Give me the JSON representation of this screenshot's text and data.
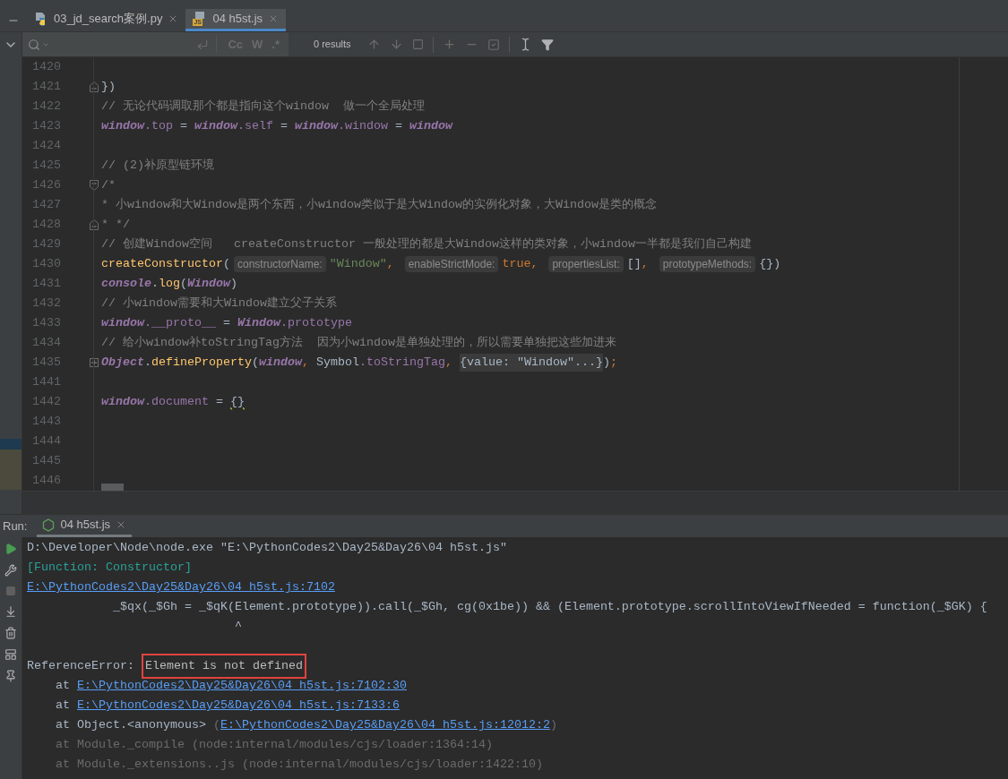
{
  "editor_tabs": [
    {
      "label": "03_jd_search案例.py",
      "selected": false
    },
    {
      "label": "04 h5st.js",
      "badge": "JS",
      "selected": true
    }
  ],
  "search_bar": {
    "toggles": [
      "Cc",
      "W",
      ".*"
    ],
    "results": "0 results"
  },
  "editor_lines": [
    {
      "number": "1420",
      "kind": "line"
    },
    {
      "number": "1421",
      "kind": "fold_end",
      "tokens": [
        {
          "kind": "plain",
          "t": "})"
        }
      ]
    },
    {
      "number": "1422",
      "kind": "line",
      "tokens": [
        {
          "kind": "comment",
          "t": "// 无论代码调取那个都是指向这个window  做一个全局处理"
        }
      ]
    },
    {
      "number": "1423",
      "kind": "line",
      "tokens": [
        {
          "kind": "global",
          "t": "window"
        },
        {
          "kind": "prop",
          "t": ".top"
        },
        {
          "kind": "plain",
          "t": " = "
        },
        {
          "kind": "global",
          "t": "window"
        },
        {
          "kind": "prop",
          "t": ".self"
        },
        {
          "kind": "plain",
          "t": " = "
        },
        {
          "kind": "global",
          "t": "window"
        },
        {
          "kind": "prop",
          "t": ".window"
        },
        {
          "kind": "plain",
          "t": " = "
        },
        {
          "kind": "global",
          "t": "window"
        }
      ]
    },
    {
      "number": "1424",
      "kind": "line"
    },
    {
      "number": "1425",
      "kind": "line",
      "tokens": [
        {
          "kind": "comment",
          "t": "// (2)补原型链环境"
        }
      ]
    },
    {
      "number": "1426",
      "kind": "fold_start",
      "tokens": [
        {
          "kind": "comment",
          "t": "/*"
        }
      ]
    },
    {
      "number": "1427",
      "kind": "line",
      "tokens": [
        {
          "kind": "comment",
          "t": "* 小window和大Window是两个东西，小window类似于是大Window的实例化对象，大Window是类的概念"
        }
      ]
    },
    {
      "number": "1428",
      "kind": "fold_end",
      "tokens": [
        {
          "kind": "comment",
          "t": "* */"
        }
      ]
    },
    {
      "number": "1429",
      "kind": "line",
      "tokens": [
        {
          "kind": "comment",
          "t": "// 创建Window空间   createConstructor 一般处理的都是大Window这样的类对象，小window一半都是我们自己构建"
        }
      ]
    },
    {
      "number": "1430",
      "kind": "line",
      "tokens": [
        {
          "kind": "func",
          "t": "createConstructor"
        },
        {
          "kind": "plain",
          "t": "("
        },
        {
          "kind": "hint",
          "t": "constructorName:"
        },
        {
          "kind": "string",
          "t": "\"Window\""
        },
        {
          "kind": "keyword",
          "t": ", "
        },
        {
          "kind": "hint",
          "t": "enableStrictMode:"
        },
        {
          "kind": "keyword",
          "t": "true, "
        },
        {
          "kind": "hint",
          "t": "propertiesList:"
        },
        {
          "kind": "plain",
          "t": "[]"
        },
        {
          "kind": "keyword",
          "t": ", "
        },
        {
          "kind": "hint",
          "t": "prototypeMethods:"
        },
        {
          "kind": "plain",
          "t": "{})"
        }
      ]
    },
    {
      "number": "1431",
      "kind": "line",
      "tokens": [
        {
          "kind": "global",
          "t": "console"
        },
        {
          "kind": "plain",
          "t": "."
        },
        {
          "kind": "func",
          "t": "log"
        },
        {
          "kind": "plain",
          "t": "("
        },
        {
          "kind": "global",
          "t": "Window"
        },
        {
          "kind": "plain",
          "t": ")"
        }
      ]
    },
    {
      "number": "1432",
      "kind": "line",
      "tokens": [
        {
          "kind": "comment",
          "t": "// 小window需要和大Window建立父子关系"
        }
      ]
    },
    {
      "number": "1433",
      "kind": "line",
      "tokens": [
        {
          "kind": "global",
          "t": "window"
        },
        {
          "kind": "prop",
          "t": ".__proto__"
        },
        {
          "kind": "plain",
          "t": " = "
        },
        {
          "kind": "global",
          "t": "Window"
        },
        {
          "kind": "prop",
          "t": ".prototype"
        }
      ]
    },
    {
      "number": "1434",
      "kind": "line",
      "tokens": [
        {
          "kind": "comment",
          "t": "// 给小window补toStringTag方法  因为小window是单独处理的，所以需要单独把这些加进来"
        }
      ]
    },
    {
      "number": "1435",
      "kind": "fold_collapsed",
      "tokens": [
        {
          "kind": "global",
          "t": "Object"
        },
        {
          "kind": "plain",
          "t": "."
        },
        {
          "kind": "func",
          "t": "defineProperty"
        },
        {
          "kind": "plain",
          "t": "("
        },
        {
          "kind": "global",
          "t": "window"
        },
        {
          "kind": "keyword",
          "t": ", "
        },
        {
          "kind": "plain",
          "t": "Symbol"
        },
        {
          "kind": "prop",
          "t": ".toStringTag"
        },
        {
          "kind": "keyword",
          "t": ", "
        },
        {
          "kind": "folded",
          "t": "{value: \"Window\"...}"
        },
        {
          "kind": "plain",
          "t": ")"
        },
        {
          "kind": "keyword",
          "t": ";"
        }
      ]
    },
    {
      "number": "1441",
      "kind": "line"
    },
    {
      "number": "1442",
      "kind": "line",
      "tokens": [
        {
          "kind": "global",
          "t": "window"
        },
        {
          "kind": "prop",
          "t": ".document"
        },
        {
          "kind": "plain",
          "t": " = "
        },
        {
          "kind": "squiggle",
          "t": "{}"
        }
      ]
    },
    {
      "number": "1443",
      "kind": "line"
    },
    {
      "number": "1444",
      "kind": "line"
    },
    {
      "number": "1445",
      "kind": "line"
    },
    {
      "number": "1446",
      "kind": "line"
    }
  ],
  "run_panel": {
    "label": "Run:",
    "tab": {
      "label": "04 h5st.js",
      "selected": true
    }
  },
  "console_lines": [
    {
      "kind": "line",
      "tokens": [
        {
          "kind": "plain",
          "t": "D:\\Developer\\Node\\node.exe \"E:\\PythonCodes2\\Day25&Day26\\04 h5st.js\""
        }
      ]
    },
    {
      "kind": "line",
      "tokens": [
        {
          "kind": "teal",
          "t": "[Function: Constructor]"
        }
      ]
    },
    {
      "kind": "line",
      "tokens": [
        {
          "kind": "link",
          "t": "E:\\PythonCodes2\\Day25&Day26\\04 h5st.js:7102"
        }
      ]
    },
    {
      "kind": "source",
      "tokens": [
        {
          "kind": "plain",
          "t": "_$qx(_$Gh = _$qK(Element.prototype)).call(_$Gh, cg(0x1be)) && (Element.prototype.scrollIntoViewIfNeeded = function(_$GK) {"
        }
      ]
    },
    {
      "kind": "caret",
      "tokens": [
        {
          "kind": "plain",
          "t": "^"
        }
      ]
    },
    {
      "kind": "line"
    },
    {
      "kind": "line",
      "tokens": [
        {
          "kind": "plain",
          "t": "ReferenceError: "
        },
        {
          "kind": "boxed",
          "t": "Element is not defined"
        }
      ]
    },
    {
      "kind": "frame",
      "tokens": [
        {
          "kind": "plain",
          "t": "at "
        },
        {
          "kind": "link",
          "t": "E:\\PythonCodes2\\Day25&Day26\\04 h5st.js:7102:30"
        }
      ]
    },
    {
      "kind": "frame",
      "tokens": [
        {
          "kind": "plain",
          "t": "at "
        },
        {
          "kind": "link",
          "t": "E:\\PythonCodes2\\Day25&Day26\\04 h5st.js:7133:6"
        }
      ]
    },
    {
      "kind": "frame",
      "tokens": [
        {
          "kind": "plain",
          "t": "at Object.<anonymous> "
        },
        {
          "kind": "dim",
          "t": "("
        },
        {
          "kind": "link",
          "t": "E:\\PythonCodes2\\Day25&Day26\\04 h5st.js:12012:2"
        },
        {
          "kind": "dim",
          "t": ")"
        }
      ]
    },
    {
      "kind": "frame",
      "tokens": [
        {
          "kind": "dim",
          "t": "at Module._compile (node:internal/modules/cjs/loader:1364:14)"
        }
      ]
    },
    {
      "kind": "frame",
      "tokens": [
        {
          "kind": "dim",
          "t": "at Module._extensions..js (node:internal/modules/cjs/loader:1422:10)"
        }
      ]
    }
  ]
}
